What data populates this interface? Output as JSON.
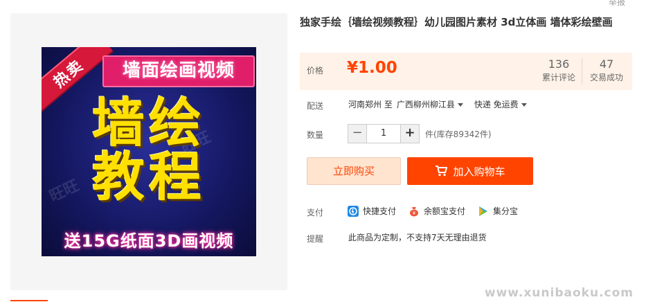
{
  "header": {
    "report_link": "举报"
  },
  "product": {
    "title": "独家手绘｛墙绘视频教程｝幼儿园图片素材 3d立体画 墙体彩绘壁画",
    "image": {
      "hot_ribbon": "热卖",
      "top_banner": "墙面绘画视频",
      "big_text_1": "墙绘",
      "big_text_2": "教程",
      "bottom_banner": "送15G纸面3D画视频",
      "watermark": "旺旺"
    }
  },
  "price": {
    "label": "价格",
    "value": "¥1.00",
    "reviews_count": "136",
    "reviews_label": "累计评论",
    "sold_count": "47",
    "sold_label": "交易成功"
  },
  "shipping": {
    "label": "配送",
    "from": "河南郑州 至",
    "to": "广西柳州柳江县",
    "method": "快递 免运费"
  },
  "quantity": {
    "label": "数量",
    "minus": "−",
    "value": "1",
    "plus": "+",
    "stock": "件(库存89342件)"
  },
  "actions": {
    "buy_now": "立即购买",
    "add_to_cart": "加入购物车"
  },
  "payment": {
    "label": "支付",
    "methods": [
      "快捷支付",
      "余额宝支付",
      "集分宝"
    ]
  },
  "notice": {
    "label": "提醒",
    "text": "此商品为定制，不支持7天无理由退货"
  },
  "site_watermark": "www.xunibaoku.com",
  "colors": {
    "accent": "#ff4400",
    "price_bg": "#fff2e8",
    "buy_bg": "#ffe4d0"
  }
}
